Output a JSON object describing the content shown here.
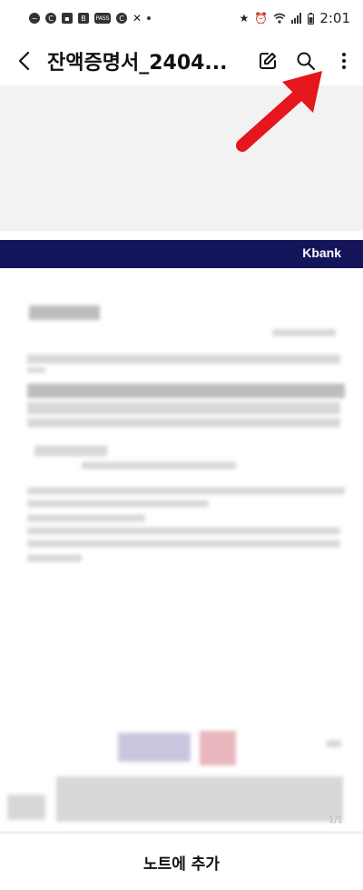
{
  "status_bar": {
    "time": "2:01",
    "left_icons": [
      "minus-circle-icon",
      "c-icon",
      "image-icon",
      "b-icon",
      "pass-icon",
      "c-icon",
      "missed-call-icon"
    ],
    "right_icons": [
      "star-icon",
      "alarm-icon",
      "wifi-icon",
      "signal-icon",
      "battery-icon"
    ]
  },
  "app_bar": {
    "title": "잔액증명서_2404..."
  },
  "document": {
    "bank_logo": "Kbank",
    "page_indicator": "1/1"
  },
  "bottom": {
    "add_to_note_label": "노트에 추가"
  },
  "colors": {
    "bank_banner": "#14145a",
    "annotation_arrow": "#e5161c"
  }
}
